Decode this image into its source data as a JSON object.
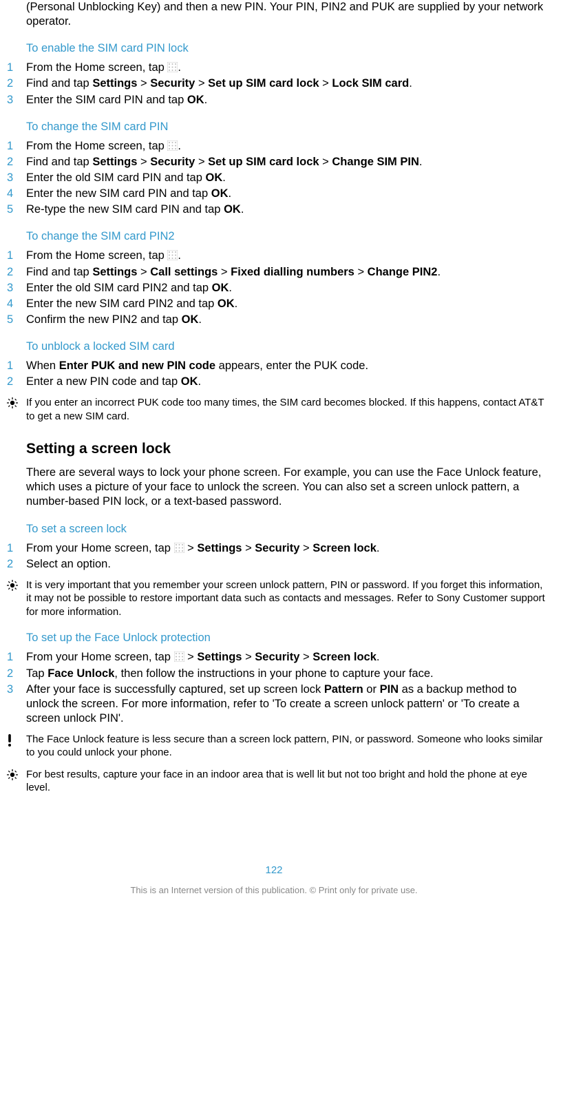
{
  "intro": "(Personal Unblocking Key) and then a new PIN. Your PIN, PIN2 and PUK are supplied by your network operator.",
  "sec1": {
    "heading": "To enable the SIM card PIN lock",
    "steps": [
      {
        "n": "1",
        "pre": "From the Home screen, tap ",
        "post": "."
      },
      {
        "n": "2",
        "html": "Find and tap <b>Settings</b> > <b>Security</b> > <b>Set up SIM card lock</b> > <b>Lock SIM card</b>."
      },
      {
        "n": "3",
        "html": "Enter the SIM card PIN and tap <b>OK</b>."
      }
    ]
  },
  "sec2": {
    "heading": "To change the SIM card PIN",
    "steps": [
      {
        "n": "1",
        "pre": "From the Home screen, tap ",
        "post": "."
      },
      {
        "n": "2",
        "html": "Find and tap <b>Settings</b> > <b>Security</b> > <b>Set up SIM card lock</b> > <b>Change SIM PIN</b>."
      },
      {
        "n": "3",
        "html": "Enter the old SIM card PIN and tap <b>OK</b>."
      },
      {
        "n": "4",
        "html": "Enter the new SIM card PIN and tap <b>OK</b>."
      },
      {
        "n": "5",
        "html": "Re-type the new SIM card PIN and tap <b>OK</b>."
      }
    ]
  },
  "sec3": {
    "heading": "To change the SIM card PIN2",
    "steps": [
      {
        "n": "1",
        "pre": "From the Home screen, tap ",
        "post": "."
      },
      {
        "n": "2",
        "html": "Find and tap <b>Settings</b> > <b>Call settings</b> > <b>Fixed dialling numbers</b> > <b>Change PIN2</b>."
      },
      {
        "n": "3",
        "html": "Enter the old SIM card PIN2 and tap <b>OK</b>."
      },
      {
        "n": "4",
        "html": "Enter the new SIM card PIN2 and tap <b>OK</b>."
      },
      {
        "n": "5",
        "html": "Confirm the new PIN2 and tap <b>OK</b>."
      }
    ]
  },
  "sec4": {
    "heading": "To unblock a locked SIM card",
    "steps": [
      {
        "n": "1",
        "html": "When <b>Enter PUK and new PIN code</b> appears, enter the PUK code."
      },
      {
        "n": "2",
        "html": "Enter a new PIN code and tap <b>OK</b>."
      }
    ],
    "note": "If you enter an incorrect PUK code too many times, the SIM card becomes blocked. If this happens, contact AT&T to get a new SIM card."
  },
  "section2": {
    "title": "Setting a screen lock",
    "intro": "There are several ways to lock your phone screen. For example, you can use the Face Unlock feature, which uses a picture of your face to unlock the screen. You can also set a screen unlock pattern, a number-based PIN lock, or a text-based password."
  },
  "sec5": {
    "heading": "To set a screen lock",
    "steps": [
      {
        "n": "1",
        "pre": "From your Home screen, tap ",
        "post": " > <b>Settings</b> > <b>Security</b> > <b>Screen lock</b>."
      },
      {
        "n": "2",
        "html": "Select an option."
      }
    ],
    "note": "It is very important that you remember your screen unlock pattern, PIN or password. If you forget this information, it may not be possible to restore important data such as contacts and messages. Refer to Sony Customer support for more information."
  },
  "sec6": {
    "heading": "To set up the Face Unlock protection",
    "steps": [
      {
        "n": "1",
        "pre": "From your Home screen, tap ",
        "post": " > <b>Settings</b> > <b>Security</b> > <b>Screen lock</b>."
      },
      {
        "n": "2",
        "html": "Tap <b>Face Unlock</b>, then follow the instructions in your phone to capture your face."
      },
      {
        "n": "3",
        "html": "After your face is successfully captured, set up screen lock <b>Pattern</b> or <b>PIN</b> as a backup method to unlock the screen. For more information, refer to 'To create a screen unlock pattern' or 'To create a screen unlock PIN'."
      }
    ],
    "warn": "The Face Unlock feature is less secure than a screen lock pattern, PIN, or password. Someone who looks similar to you could unlock your phone.",
    "tip": "For best results, capture your face in an indoor area that is well lit but not too bright and hold the phone at eye level."
  },
  "pageNumber": "122",
  "footer": "This is an Internet version of this publication. © Print only for private use."
}
